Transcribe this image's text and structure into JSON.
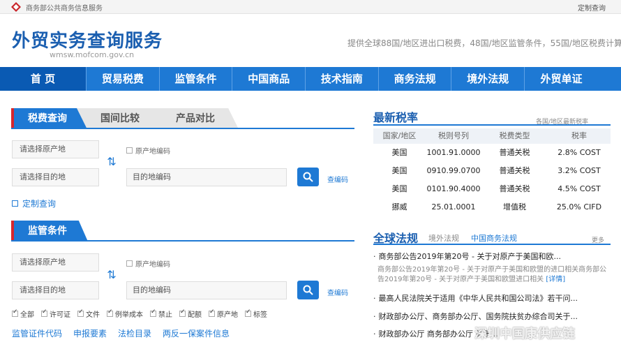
{
  "topbar": {
    "org": "商务部公共商务信息服务",
    "login": "定制查询"
  },
  "header": {
    "title": "外贸实务查询服务",
    "domain": "wmsw.mofcom.gov.cn",
    "desc": "提供全球88国/地区进出口税费，48国/地区监管条件，55国/地区税费计算"
  },
  "nav": [
    "首 页",
    "贸易税费",
    "监管条件",
    "中国商品",
    "技术指南",
    "商务法规",
    "境外法规",
    "外贸单证"
  ],
  "tax_query": {
    "tabs": [
      "税费查询",
      "国间比较",
      "产品对比"
    ],
    "origin_placeholder": "请选择原产地",
    "origin_code_label": "原产地编码",
    "dest_placeholder": "请选择目的地",
    "dest_code_placeholder": "目的地编码",
    "code_lookup": "查编码",
    "custom_query": "定制查询"
  },
  "supervision": {
    "title": "监管条件",
    "origin_placeholder": "请选择原产地",
    "origin_code_label": "原产地编码",
    "dest_placeholder": "请选择目的地",
    "dest_code_placeholder": "目的地编码",
    "code_lookup": "查编码",
    "filters": [
      "全部",
      "许可证",
      "文件",
      "例举成本",
      "禁止",
      "配额",
      "原产地",
      "标签"
    ],
    "links": [
      "监管证件代码",
      "申报要素",
      "法检目录",
      "两反一保案件信息"
    ]
  },
  "latest_rates": {
    "title": "最新税率",
    "more": "各国/地区最新税率",
    "headers": [
      "国家/地区",
      "税则号列",
      "税费类型",
      "税率"
    ],
    "rows": [
      [
        "美国",
        "1001.91.0000",
        "普通关税",
        "2.8% COST"
      ],
      [
        "美国",
        "0910.99.0700",
        "普通关税",
        "3.2% COST"
      ],
      [
        "美国",
        "0101.90.4000",
        "普通关税",
        "4.5% COST"
      ],
      [
        "挪威",
        "25.01.0001",
        "增值税",
        "25.0% CIFD"
      ]
    ]
  },
  "global_law": {
    "title": "全球法规",
    "tabs": [
      "境外法规",
      "中国商务法规"
    ],
    "more": "更多",
    "items": [
      "商务部公告2019年第20号 - 关于对原产于美国和欧...",
      "最高人民法院关于适用《中华人民共和国公司法》若干问...",
      "财政部办公厅、商务部办公厅、国务院扶贫办综合司关于...",
      "财政部办公厅 商务部办公厅 关于..."
    ],
    "snippet": "商务部公告2019年第20号 - 关于对原产于美国和欧盟的进口相关商务部公告2019年第20号 - 关于对原产于美国和欧盟进口相关",
    "snippet_detail": "[详情]"
  },
  "watermark": "深圳中国康供应链"
}
